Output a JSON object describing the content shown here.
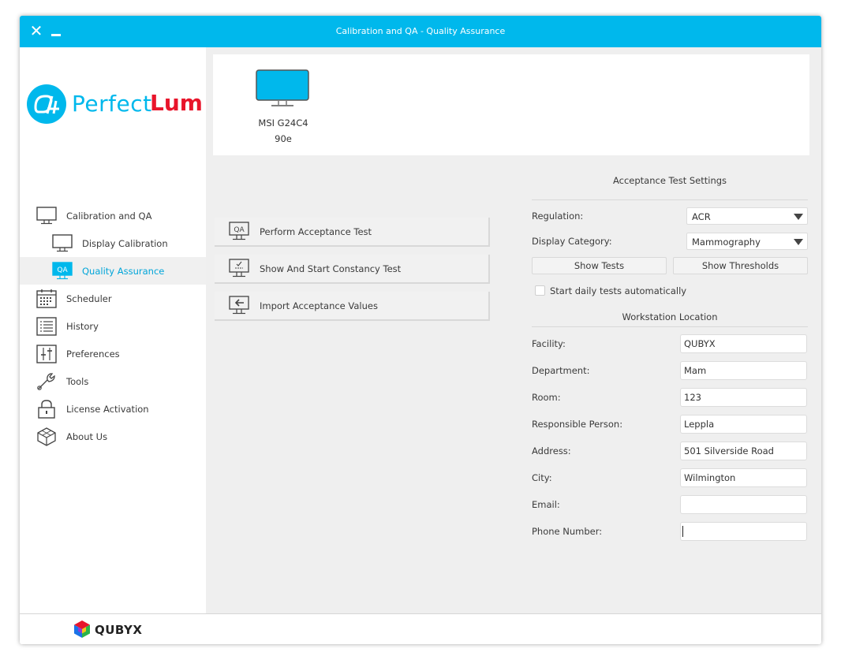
{
  "window": {
    "title": "Calibration and QA - Quality Assurance",
    "close_glyph": "✕",
    "accent_color": "#00b8ec"
  },
  "logo": {
    "word1": "Perfect",
    "word2": "Lum",
    "word1_color": "#00b8ec",
    "word2_color": "#e8152b"
  },
  "sidebar": {
    "items": [
      {
        "label": "Calibration and QA",
        "icon": "monitor-icon"
      },
      {
        "label": "Display Calibration",
        "icon": "monitor-icon"
      },
      {
        "label": "Quality Assurance",
        "icon": "qa-monitor-icon",
        "active": true
      },
      {
        "label": "Scheduler",
        "icon": "calendar-icon"
      },
      {
        "label": "History",
        "icon": "list-icon"
      },
      {
        "label": "Preferences",
        "icon": "sliders-icon"
      },
      {
        "label": "Tools",
        "icon": "wrench-icon"
      },
      {
        "label": "License Activation",
        "icon": "lock-icon"
      },
      {
        "label": "About Us",
        "icon": "cube-icon"
      }
    ],
    "qa_icon_text": "QA"
  },
  "display": {
    "name": "MSI G24C4",
    "sub": "90e"
  },
  "actions": [
    {
      "label": "Perform Acceptance Test",
      "icon": "qa-monitor-icon",
      "icon_text": "QA"
    },
    {
      "label": "Show And Start Constancy Test",
      "icon": "checklist-monitor-icon"
    },
    {
      "label": "Import Acceptance Values",
      "icon": "import-monitor-icon"
    }
  ],
  "acceptance": {
    "title": "Acceptance Test Settings",
    "regulation_label": "Regulation:",
    "regulation_value": "ACR",
    "category_label": "Display Category:",
    "category_value": "Mammography",
    "show_tests": "Show Tests",
    "show_thresholds": "Show Thresholds",
    "daily_label": "Start daily tests automatically",
    "daily_checked": false
  },
  "workstation": {
    "title": "Workstation Location",
    "fields": [
      {
        "label": "Facility:",
        "value": "QUBYX"
      },
      {
        "label": "Department:",
        "value": "Mam"
      },
      {
        "label": "Room:",
        "value": "123"
      },
      {
        "label": "Responsible Person:",
        "value": "Leppla"
      },
      {
        "label": "Address:",
        "value": "501 Silverside Road"
      },
      {
        "label": "City:",
        "value": "Wilmington"
      },
      {
        "label": "Email:",
        "value": ""
      },
      {
        "label": "Phone Number:",
        "value": ""
      }
    ]
  },
  "footer": {
    "brand": "QUBYX"
  }
}
